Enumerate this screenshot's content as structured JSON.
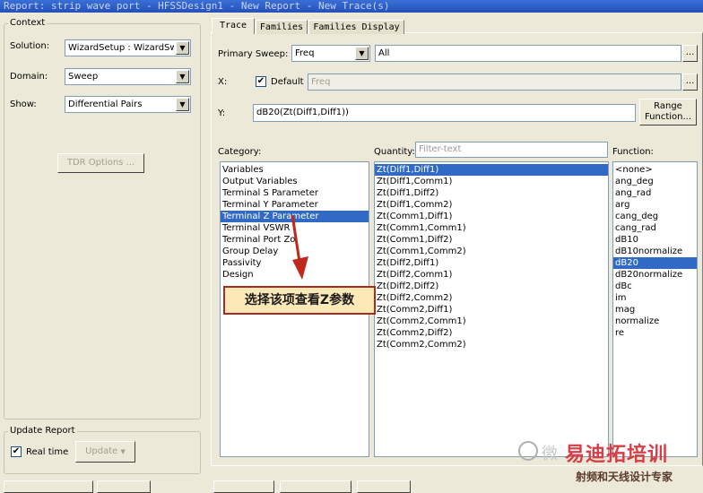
{
  "window": {
    "title": "Report: strip wave port - HFSSDesign1 - New Report - New Trace(s)"
  },
  "context": {
    "group_label": "Context",
    "solution_label": "Solution:",
    "solution_value": "WizardSetup : WizardSweep",
    "domain_label": "Domain:",
    "domain_value": "Sweep",
    "show_label": "Show:",
    "show_value": "Differential Pairs",
    "tdr_button": "TDR Options ..."
  },
  "update_report": {
    "group_label": "Update Report",
    "realtime_label": "Real time",
    "realtime_checked": true,
    "update_button": "Update"
  },
  "tabs": [
    "Trace",
    "Families",
    "Families Display"
  ],
  "trace": {
    "primary_sweep_label": "Primary Sweep:",
    "primary_sweep_value": "Freq",
    "primary_sweep_range": "All",
    "x_label": "X:",
    "default_label": "Default",
    "default_checked": true,
    "x_value": "Freq",
    "y_label": "Y:",
    "y_value": "dB20(Zt(Diff1,Diff1))",
    "range_function_line1": "Range",
    "range_function_line2": "Function...",
    "ellipsis": "..."
  },
  "category": {
    "label": "Category:",
    "items": [
      "Variables",
      "Output Variables",
      "Terminal S Parameter",
      "Terminal Y Parameter",
      "Terminal Z Parameter",
      "Terminal VSWR",
      "Terminal Port Zo",
      "Group Delay",
      "Passivity",
      "Design"
    ],
    "selected": 4
  },
  "quantity": {
    "label": "Quantity:",
    "filter_placeholder": "Filter-text",
    "items": [
      "Zt(Diff1,Diff1)",
      "Zt(Diff1,Comm1)",
      "Zt(Diff1,Diff2)",
      "Zt(Diff1,Comm2)",
      "Zt(Comm1,Diff1)",
      "Zt(Comm1,Comm1)",
      "Zt(Comm1,Diff2)",
      "Zt(Comm1,Comm2)",
      "Zt(Diff2,Diff1)",
      "Zt(Diff2,Comm1)",
      "Zt(Diff2,Diff2)",
      "Zt(Diff2,Comm2)",
      "Zt(Comm2,Diff1)",
      "Zt(Comm2,Comm1)",
      "Zt(Comm2,Diff2)",
      "Zt(Comm2,Comm2)"
    ],
    "selected": 0
  },
  "function": {
    "label": "Function:",
    "items": [
      "<none>",
      "ang_deg",
      "ang_rad",
      "arg",
      "cang_deg",
      "cang_rad",
      "dB10",
      "dB10normalize",
      "dB20",
      "dB20normalize",
      "dBc",
      "im",
      "mag",
      "normalize",
      "re"
    ],
    "selected": 8
  },
  "annotation": {
    "callout_text": "选择该项查看Z参数",
    "arrow_color": "#c0281c"
  },
  "watermark": {
    "logo_text": "微",
    "brand_text": "易迪拓培训",
    "sub_text": "射频和天线设计专家"
  },
  "colors": {
    "selection": "#316ac5",
    "background": "#ece9d8",
    "accent_red": "#c0281c"
  }
}
